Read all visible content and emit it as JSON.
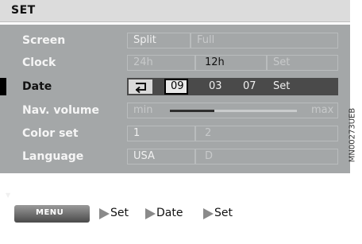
{
  "header": {
    "title": "SET"
  },
  "menu_rows": [
    {
      "label": "Screen",
      "options": [
        "Split",
        "Full"
      ]
    },
    {
      "label": "Clock",
      "options": [
        "24h",
        "12h",
        "Set"
      ]
    },
    {
      "label": "Date",
      "selected": true,
      "date_values": {
        "day": "09",
        "month": "03",
        "year": "07"
      },
      "set_label": "Set",
      "icon": "return-arrow-icon"
    },
    {
      "label": "Nav. volume",
      "min_label": "min",
      "max_label": "max",
      "level": 0.35
    },
    {
      "label": "Color set",
      "options": [
        "1",
        "2"
      ]
    },
    {
      "label": "Language",
      "options": [
        "USA",
        "D"
      ]
    }
  ],
  "instruction": {
    "menu_button": "MENU",
    "steps": [
      "Set",
      "Date",
      "Set"
    ]
  },
  "side_code": "MN00273UEB",
  "colors": {
    "screen_bg": "#a4a7a8",
    "date_bar": "#4a4a4a",
    "marker": "#000000"
  }
}
